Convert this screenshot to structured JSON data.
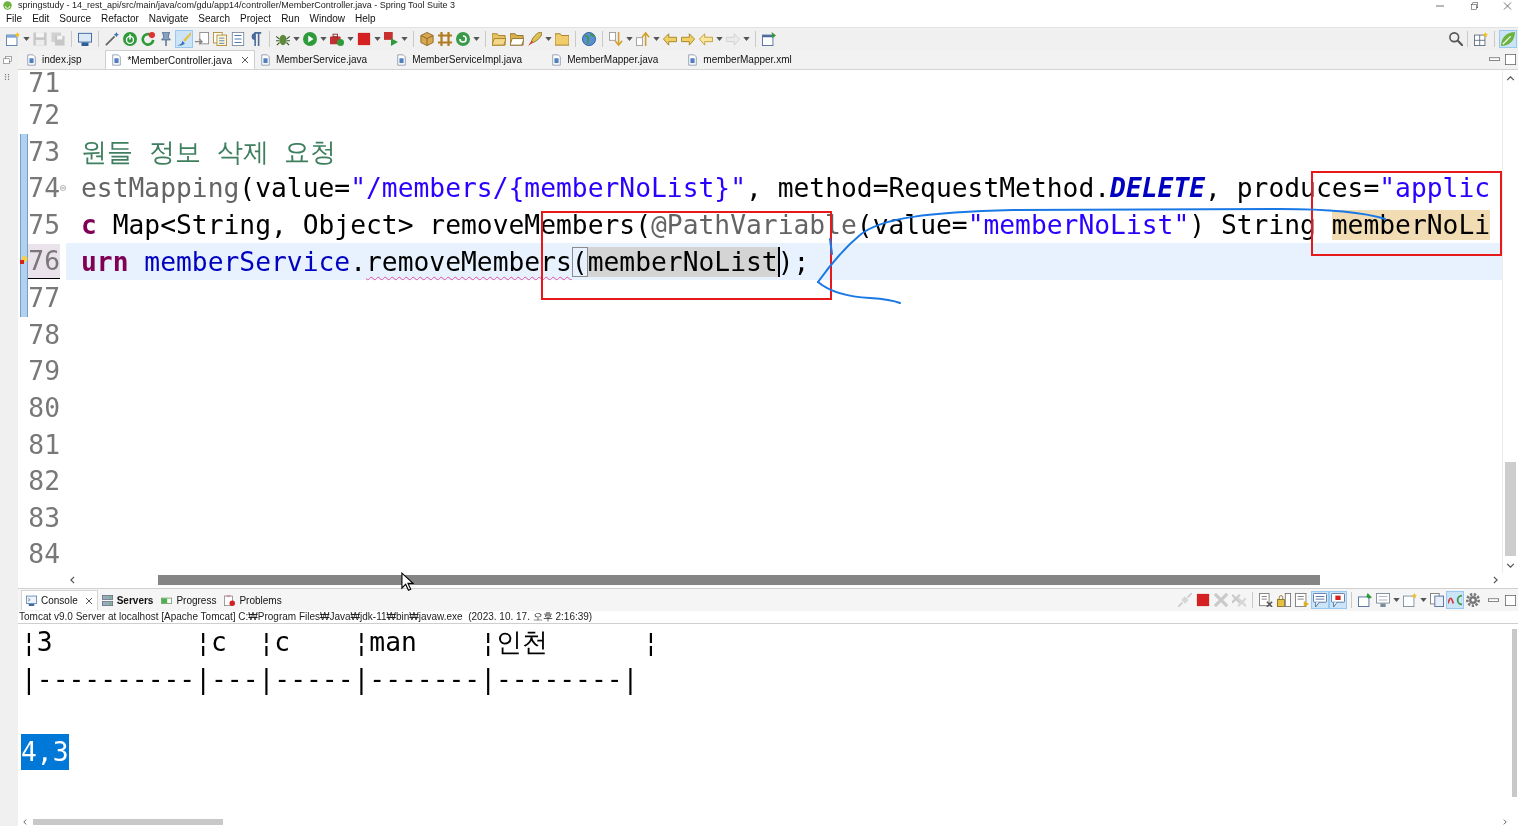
{
  "window": {
    "title": "springstudy - 14_rest_api/src/main/java/com/gdu/app14/controller/MemberController.java - Spring Tool Suite 3"
  },
  "menu": [
    "File",
    "Edit",
    "Source",
    "Refactor",
    "Navigate",
    "Search",
    "Project",
    "Run",
    "Window",
    "Help"
  ],
  "main_toolbar": {
    "buttons": [
      {
        "pressed": false,
        "disabled": false
      },
      {
        "pressed": false,
        "disabled": true
      },
      {
        "pressed": false,
        "disabled": true
      },
      {
        "pressed": false,
        "disabled": false
      },
      {
        "pressed": false,
        "disabled": false
      },
      {
        "pressed": false,
        "disabled": false
      },
      {
        "pressed": false,
        "disabled": false
      },
      {
        "pressed": false,
        "disabled": false
      },
      {
        "pressed": true,
        "disabled": false
      },
      {
        "pressed": false,
        "disabled": false
      },
      {
        "pressed": false,
        "disabled": false
      },
      {
        "pressed": false,
        "disabled": false
      },
      {
        "pressed": false,
        "disabled": false
      },
      {
        "pressed": false,
        "disabled": false
      },
      {
        "pressed": false,
        "disabled": false
      },
      {
        "pressed": false,
        "disabled": false
      },
      {
        "pressed": false,
        "disabled": false
      },
      {
        "pressed": false,
        "disabled": false
      },
      {
        "pressed": false,
        "disabled": false
      },
      {
        "pressed": false,
        "disabled": false
      },
      {
        "pressed": false,
        "disabled": false
      },
      {
        "pressed": false,
        "disabled": false
      },
      {
        "pressed": false,
        "disabled": false
      },
      {
        "pressed": false,
        "disabled": false
      },
      {
        "pressed": false,
        "disabled": false
      },
      {
        "pressed": false,
        "disabled": false
      },
      {
        "pressed": false,
        "disabled": false
      },
      {
        "pressed": false,
        "disabled": false
      },
      {
        "pressed": false,
        "disabled": false
      },
      {
        "pressed": false,
        "disabled": false
      },
      {
        "pressed": false,
        "disabled": false
      },
      {
        "pressed": false,
        "disabled": true
      },
      {
        "pressed": false,
        "disabled": false
      }
    ]
  },
  "perspective_bar": {
    "buttons": [
      {
        "pressed": false
      },
      {
        "pressed": true
      }
    ]
  },
  "editor_tabs": [
    {
      "label": "index.jsp",
      "selected": false
    },
    {
      "label": "*MemberController.java",
      "selected": true
    },
    {
      "label": "MemberService.java",
      "selected": false
    },
    {
      "label": "MemberServiceImpl.java",
      "selected": false
    },
    {
      "label": "MemberMapper.java",
      "selected": false
    },
    {
      "label": "memberMapper.xml",
      "selected": false
    }
  ],
  "editor": {
    "lines": [
      {
        "number": "71",
        "current": false,
        "changed": false,
        "folding": false,
        "problem": false
      },
      {
        "number": "72",
        "current": false,
        "changed": false,
        "folding": false,
        "problem": false
      },
      {
        "number": "73",
        "current": false,
        "changed": true,
        "folding": false,
        "problem": false,
        "tokens": [
          {
            "text": "원들 정보 삭제 요청",
            "kind": "comment",
            "marked": false,
            "caret": false
          }
        ]
      },
      {
        "number": "74",
        "current": false,
        "changed": true,
        "folding": true,
        "problem": false,
        "tokens": [
          {
            "text": "estMapping",
            "kind": "annotation",
            "marked": false,
            "caret": false
          },
          {
            "text": "(value=",
            "kind": "plain",
            "marked": false,
            "caret": false
          },
          {
            "text": "\"/members/{memberNoList}\"",
            "kind": "string",
            "marked": false,
            "caret": false
          },
          {
            "text": ", method=RequestMethod.",
            "kind": "plain",
            "marked": false,
            "caret": false
          },
          {
            "text": "DELETE",
            "kind": "constant",
            "marked": false,
            "caret": false
          },
          {
            "text": ", produces=",
            "kind": "plain",
            "marked": false,
            "caret": false
          },
          {
            "text": "\"applic",
            "kind": "string",
            "marked": false,
            "caret": false
          }
        ]
      },
      {
        "number": "75",
        "current": false,
        "changed": true,
        "folding": false,
        "problem": false,
        "tokens": [
          {
            "text": "c ",
            "kind": "keyword",
            "marked": false,
            "caret": false
          },
          {
            "text": "Map<String, Object> removeMembers(",
            "kind": "plain",
            "marked": false,
            "caret": false
          },
          {
            "text": "@PathVariable",
            "kind": "annotation",
            "marked": false,
            "caret": false
          },
          {
            "text": "(value=",
            "kind": "plain",
            "marked": false,
            "caret": false
          },
          {
            "text": "\"memberNoList\"",
            "kind": "string",
            "marked": false,
            "caret": false
          },
          {
            "text": ") String ",
            "kind": "plain",
            "marked": false,
            "caret": false
          },
          {
            "text": "memberNoLi",
            "kind": "declaration",
            "marked": true,
            "caret": false
          }
        ]
      },
      {
        "number": "76",
        "current": true,
        "changed": true,
        "folding": false,
        "problem": true,
        "tokens": [
          {
            "text": "urn ",
            "kind": "keyword",
            "marked": false,
            "caret": false
          },
          {
            "text": "memberService",
            "kind": "field",
            "marked": false,
            "caret": false
          },
          {
            "text": ".",
            "kind": "plain",
            "marked": false,
            "caret": false
          },
          {
            "text": "removeMembers",
            "kind": "unresolved",
            "marked": false,
            "caret": false
          },
          {
            "text": "(",
            "kind": "matched-bracket",
            "marked": false,
            "caret": false
          },
          {
            "text": "memberNoList",
            "kind": "plain",
            "marked": true,
            "caret": true
          },
          {
            "text": ");",
            "kind": "plain",
            "marked": false,
            "caret": false
          }
        ]
      },
      {
        "number": "77",
        "current": false,
        "changed": true,
        "folding": false,
        "problem": false
      },
      {
        "number": "78",
        "current": false,
        "changed": false,
        "folding": false,
        "problem": false
      },
      {
        "number": "79",
        "current": false,
        "changed": false,
        "folding": false,
        "problem": false
      },
      {
        "number": "80",
        "current": false,
        "changed": false,
        "folding": false,
        "problem": false
      },
      {
        "number": "81",
        "current": false,
        "changed": false,
        "folding": false,
        "problem": false
      },
      {
        "number": "82",
        "current": false,
        "changed": false,
        "folding": false,
        "problem": false
      },
      {
        "number": "83",
        "current": false,
        "changed": false,
        "folding": false,
        "problem": false
      },
      {
        "number": "84",
        "current": false,
        "changed": false,
        "folding": false,
        "problem": false
      }
    ]
  },
  "console": {
    "tabs": [
      {
        "label": "Console",
        "selected": true,
        "highlighted": false
      },
      {
        "label": "Servers",
        "selected": false,
        "highlighted": true
      },
      {
        "label": "Progress",
        "selected": false,
        "highlighted": false
      },
      {
        "label": "Problems",
        "selected": false,
        "highlighted": false
      }
    ],
    "toolbar": {
      "buttons": [
        {
          "pressed": false,
          "disabled": true
        },
        {
          "pressed": false,
          "disabled": false
        },
        {
          "pressed": false,
          "disabled": true
        },
        {
          "pressed": false,
          "disabled": true
        },
        {
          "pressed": false,
          "disabled": false
        },
        {
          "pressed": false,
          "disabled": false
        },
        {
          "pressed": false,
          "disabled": false
        },
        {
          "pressed": true,
          "disabled": false
        },
        {
          "pressed": true,
          "disabled": false
        },
        {
          "pressed": false,
          "disabled": false
        },
        {
          "pressed": false,
          "disabled": false
        },
        {
          "pressed": false,
          "disabled": false
        },
        {
          "pressed": false,
          "disabled": false
        },
        {
          "pressed": true,
          "disabled": false
        },
        {
          "pressed": false,
          "disabled": false
        }
      ]
    },
    "description": "Tomcat v9.0 Server at localhost [Apache Tomcat] C:₩Program Files₩Java₩jdk-11₩bin₩javaw.exe  (2023. 10. 17. 오후 2:16:39)",
    "lines": [
      {
        "kind": "text",
        "text": "¦3         ¦c  ¦c    ¦man    ¦인천      ¦",
        "selected": false
      },
      {
        "kind": "text",
        "text": "|----------|---|-----|-------|--------|",
        "selected": false
      },
      {
        "kind": "blank"
      },
      {
        "kind": "text",
        "text": "4,3",
        "selected": true
      }
    ]
  }
}
